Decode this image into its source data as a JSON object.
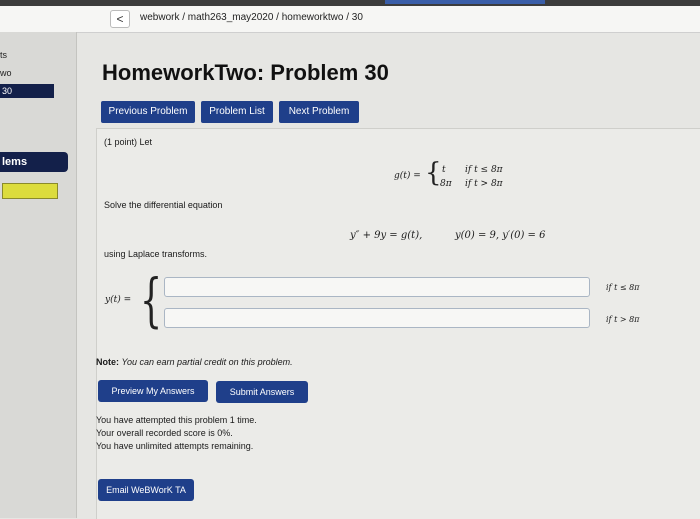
{
  "browser": {
    "back_label": "<",
    "breadcrumb": "webwork / math263_may2020 / homeworktwo / 30"
  },
  "sidebar": {
    "fragments": [
      "ts",
      "wo",
      "30"
    ],
    "problems_label": "lems",
    "progress": 1.0,
    "colors": {
      "nav": "#13204a",
      "progress": "#d4d44a"
    }
  },
  "page": {
    "title": "HomeworkTwo: Problem 30"
  },
  "nav": {
    "previous": "Previous Problem",
    "list": "Problem List",
    "next": "Next Problem"
  },
  "problem": {
    "points": "(1 point) Let",
    "g_lhs": "g(t) =",
    "g_case1_value": "t",
    "g_case1_cond": "if t ≤ 8π",
    "g_case2_value": "8π",
    "g_case2_cond": "if t > 8π",
    "instruction": "Solve the differential equation",
    "ode": "y″ + 9y = g(t),",
    "initial": "y(0) = 9, y′(0) = 6",
    "method": "using Laplace transforms.",
    "y_lhs": "y(t) =",
    "answer1_value": "",
    "answer2_value": "",
    "answer1_cond": "if t ≤ 8π",
    "answer2_cond": "if t > 8π",
    "note_label": "Note:",
    "note_text": "You can earn partial credit on this problem."
  },
  "actions": {
    "preview": "Preview My Answers",
    "submit": "Submit Answers",
    "email": "Email WeBWorK TA"
  },
  "status": {
    "attempts": "You have attempted this problem 1 time.",
    "score": "Your overall recorded score is 0%.",
    "remaining": "You have unlimited attempts remaining."
  },
  "colors": {
    "button": "#1f3f8a",
    "background": "#e6e6e3"
  }
}
